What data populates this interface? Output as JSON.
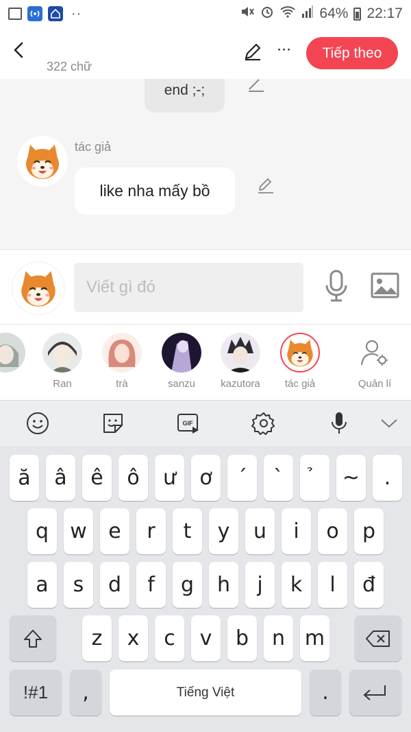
{
  "status_bar": {
    "battery": "64%",
    "time": "22:17",
    "more_dots": "··"
  },
  "header": {
    "word_count": "322 chữ",
    "next_label": "Tiếp theo",
    "more_label": "···"
  },
  "chat": {
    "messages": [
      {
        "text": "end ;-;"
      },
      {
        "author": "tác giả",
        "text": "like nha mấy bồ"
      }
    ]
  },
  "composer": {
    "placeholder": "Viết gì đó"
  },
  "characters": [
    {
      "name": ""
    },
    {
      "name": "Ran"
    },
    {
      "name": "trà"
    },
    {
      "name": "sanzu"
    },
    {
      "name": "kazutora"
    },
    {
      "name": "tác giả",
      "selected": true
    }
  ],
  "manage_label": "Quản lí",
  "keyboard": {
    "row1": [
      "ă",
      "â",
      "ê",
      "ô",
      "ư",
      "ơ",
      "´",
      "`",
      "̉",
      "~",
      "."
    ],
    "row2": [
      "q",
      "w",
      "e",
      "r",
      "t",
      "y",
      "u",
      "i",
      "o",
      "p"
    ],
    "row3": [
      "a",
      "s",
      "d",
      "f",
      "g",
      "h",
      "j",
      "k",
      "l",
      "đ"
    ],
    "row4": [
      "z",
      "x",
      "c",
      "v",
      "b",
      "n",
      "m"
    ],
    "symbols_label": "!#1",
    "comma": ",",
    "space_label": "Tiếng Việt",
    "period": "."
  },
  "colors": {
    "accent": "#f34552",
    "chat_bg": "#f5f5f5",
    "keyboard_bg": "#e4e6e9"
  }
}
